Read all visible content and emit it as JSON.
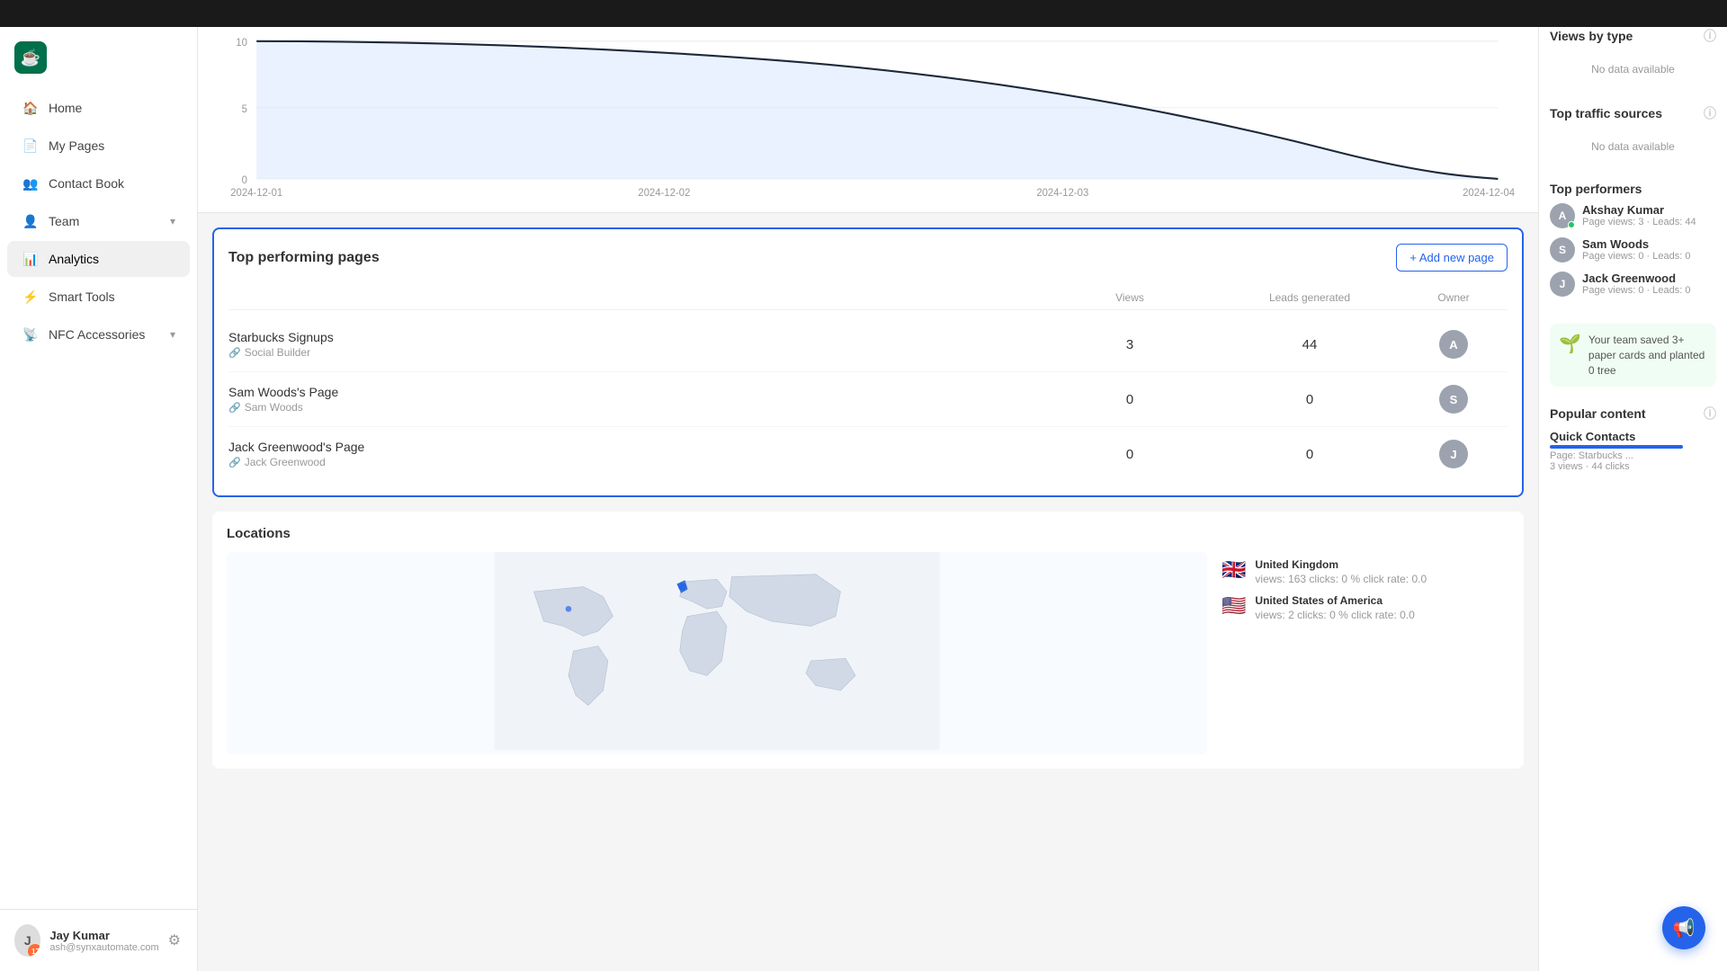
{
  "topBar": {},
  "sidebar": {
    "logo": "☕",
    "nav": [
      {
        "id": "home",
        "label": "Home",
        "icon": "🏠",
        "active": false,
        "hasChevron": false
      },
      {
        "id": "my-pages",
        "label": "My Pages",
        "icon": "📄",
        "active": false,
        "hasChevron": false
      },
      {
        "id": "contact-book",
        "label": "Contact Book",
        "icon": "👥",
        "active": false,
        "hasChevron": false
      },
      {
        "id": "team",
        "label": "Team",
        "icon": "👤",
        "active": false,
        "hasChevron": true
      },
      {
        "id": "analytics",
        "label": "Analytics",
        "icon": "📊",
        "active": true,
        "hasChevron": false
      },
      {
        "id": "smart-tools",
        "label": "Smart Tools",
        "icon": "⚡",
        "active": false,
        "hasChevron": false
      },
      {
        "id": "nfc-accessories",
        "label": "NFC Accessories",
        "icon": "📡",
        "active": false,
        "hasChevron": true
      }
    ],
    "footer": {
      "name": "Jay Kumar",
      "email": "ash@synxautomate.com",
      "badge": "17",
      "initials": "J"
    }
  },
  "chart": {
    "yAxisLabels": [
      "0",
      "5",
      "10"
    ],
    "xAxisLabels": [
      "2024-12-01",
      "2024-12-02",
      "2024-12-03",
      "2024-12-04"
    ]
  },
  "topPerformingPages": {
    "title": "Top performing pages",
    "addButton": "+ Add new page",
    "columns": {
      "views": "Views",
      "leadsGenerated": "Leads generated",
      "owner": "Owner"
    },
    "rows": [
      {
        "name": "Starbucks Signups",
        "sub": "Social Builder",
        "views": "3",
        "leads": "44",
        "ownerInitial": "A",
        "ownerColor": "#6b7280"
      },
      {
        "name": "Sam Woods's Page",
        "sub": "Sam Woods",
        "views": "0",
        "leads": "0",
        "ownerInitial": "S",
        "ownerColor": "#6b7280"
      },
      {
        "name": "Jack Greenwood's Page",
        "sub": "Jack Greenwood",
        "views": "0",
        "leads": "0",
        "ownerInitial": "J",
        "ownerColor": "#6b7280"
      }
    ]
  },
  "locations": {
    "title": "Locations",
    "items": [
      {
        "flag": "🇬🇧",
        "name": "United Kingdom",
        "stats": "views: 163 clicks: 0 % click rate: 0.0"
      },
      {
        "flag": "🇺🇸",
        "name": "United States of America",
        "stats": "views: 2 clicks: 0 % click rate: 0.0"
      }
    ]
  },
  "rightPanel": {
    "viewsByType": {
      "title": "Views by type",
      "noData": "No data available"
    },
    "topTrafficSources": {
      "title": "Top traffic sources",
      "noData": "No data available"
    },
    "topPerformers": {
      "title": "Top performers",
      "items": [
        {
          "initial": "A",
          "name": "Akshay Kumar",
          "stats": "Page views: 3 · Leads: 44",
          "color": "#6b7280",
          "hasDot": true
        },
        {
          "initial": "S",
          "name": "Sam Woods",
          "stats": "Page views: 0 · Leads: 0",
          "color": "#6b7280",
          "hasDot": false
        },
        {
          "initial": "J",
          "name": "Jack Greenwood",
          "stats": "Page views: 0 · Leads: 0",
          "color": "#6b7280",
          "hasDot": false
        }
      ]
    },
    "ecoCard": {
      "icon": "🌱",
      "text": "Your team saved 3+ paper cards and planted 0 tree"
    },
    "popularContent": {
      "title": "Popular content",
      "items": [
        {
          "name": "Quick Contacts",
          "subLabel": "Page: Starbucks ...",
          "stats": "3 views · 44 clicks"
        }
      ]
    }
  },
  "fab": {
    "icon": "📢"
  }
}
